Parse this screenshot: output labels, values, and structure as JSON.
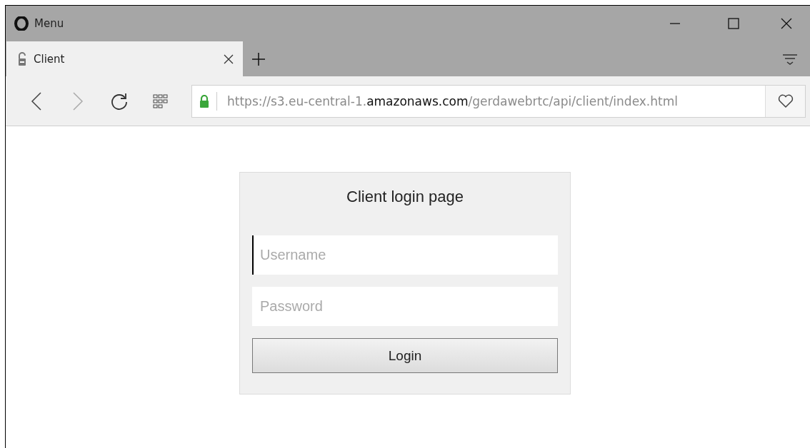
{
  "title_bar": {
    "menu_label": "Menu"
  },
  "tabs": [
    {
      "label": "Client",
      "selected": true
    }
  ],
  "address_bar": {
    "url_prefix": "https://s3.eu-central-1.",
    "url_domain": "amazonaws.com",
    "url_path": "/gerdawebrtc/api/client/index.html"
  },
  "login_card": {
    "title": "Client login page",
    "fields": [
      {
        "placeholder": "Username",
        "focused": true
      },
      {
        "placeholder": "Password",
        "focused": false
      }
    ],
    "button": "Login"
  }
}
